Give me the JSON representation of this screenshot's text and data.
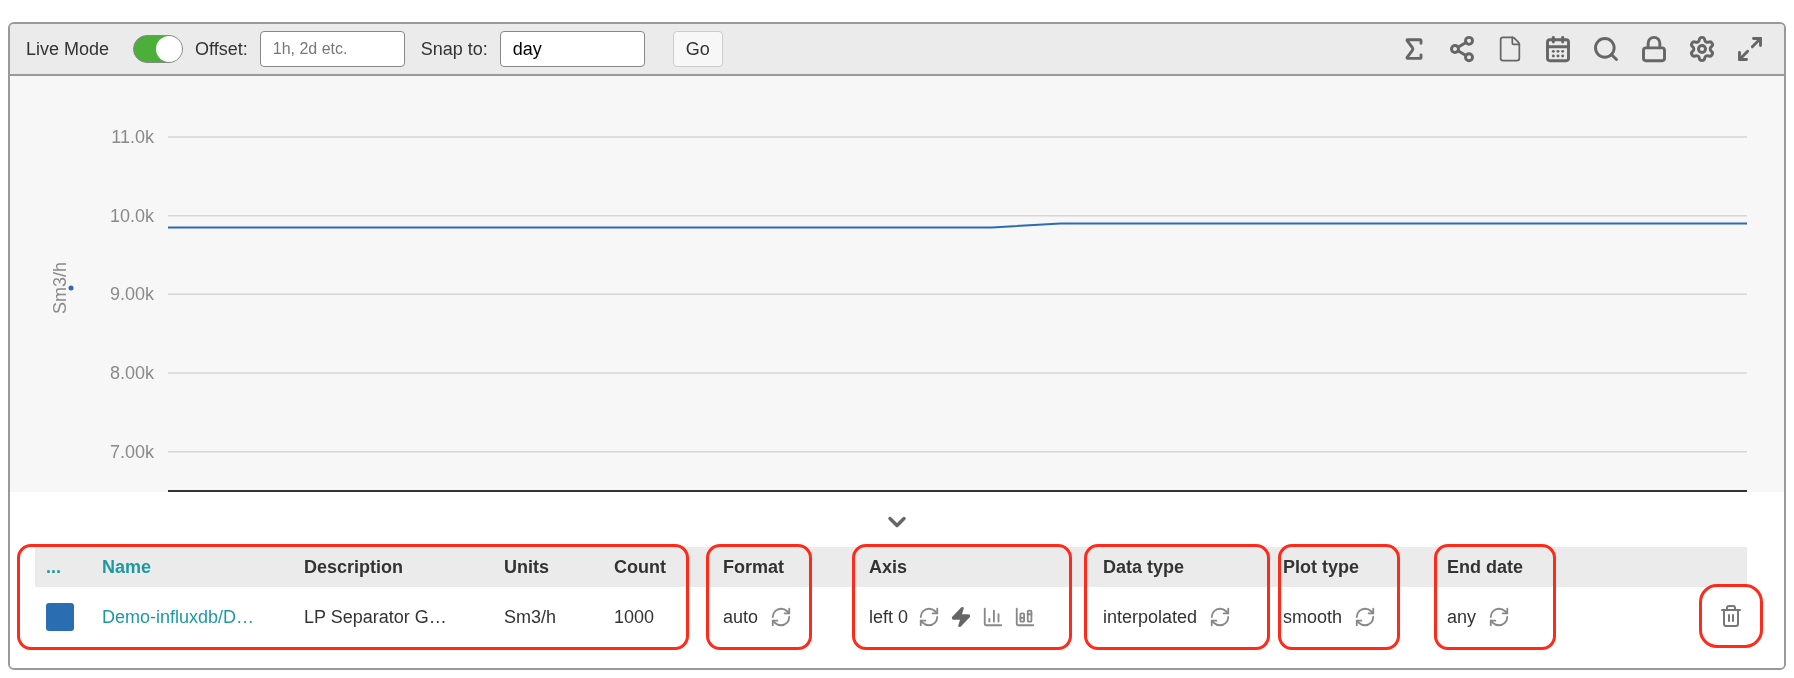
{
  "toolbar": {
    "live_mode": {
      "label": "Live Mode",
      "on": true
    },
    "offset": {
      "label": "Offset:",
      "placeholder": "1h, 2d etc."
    },
    "snap": {
      "label": "Snap to:",
      "value": "day"
    },
    "go_button": "Go"
  },
  "chart_data": {
    "type": "line",
    "ylabel": "Sm3/h",
    "ylim": [
      6500,
      11000
    ],
    "grid": true,
    "yticks": [
      {
        "value": 7000,
        "label": "7.00k"
      },
      {
        "value": 8000,
        "label": "8.00k"
      },
      {
        "value": 9000,
        "label": "9.00k"
      },
      {
        "value": 10000,
        "label": "10.0k"
      },
      {
        "value": 11000,
        "label": "11.0k"
      }
    ],
    "series": [
      {
        "color": "#2a6db0",
        "values": [
          9850,
          9850,
          9850,
          9850,
          9850,
          9850,
          9850,
          9850,
          9850,
          9850,
          9850,
          9850,
          9850,
          9900,
          9900,
          9900,
          9900,
          9900,
          9900,
          9900,
          9900,
          9900,
          9900,
          9900
        ]
      }
    ]
  },
  "table": {
    "columns": [
      {
        "label": "...",
        "kind": "link"
      },
      {
        "label": "Name",
        "kind": "link"
      },
      {
        "label": "Description",
        "kind": "plain"
      },
      {
        "label": "Units",
        "kind": "plain"
      },
      {
        "label": "Count",
        "kind": "plain"
      },
      {
        "label": "Format",
        "kind": "plain"
      },
      {
        "label": "Axis",
        "kind": "plain"
      },
      {
        "label": "Data type",
        "kind": "plain"
      },
      {
        "label": "Plot type",
        "kind": "plain"
      },
      {
        "label": "End date",
        "kind": "plain"
      }
    ],
    "rows": [
      {
        "color": "#2a6db0",
        "name": "Demo-influxdb/D…",
        "description": "LP Separator G…",
        "units": "Sm3/h",
        "count": "1000",
        "format": "auto",
        "axis": "left 0",
        "data_type": "interpolated",
        "plot_type": "smooth",
        "end_date": "any"
      }
    ]
  }
}
